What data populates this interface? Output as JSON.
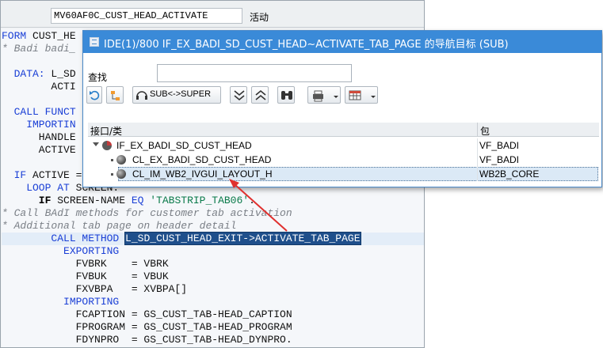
{
  "editor": {
    "object_name": "MV60AF0C_CUST_HEAD_ACTIVATE",
    "status": "活动",
    "lines": [
      {
        "parts": [
          {
            "t": "FORM",
            "c": "k-blue"
          },
          {
            "t": " CUST_HE",
            "c": ""
          }
        ]
      },
      {
        "parts": [
          {
            "t": "* Badi badi_",
            "c": "c-comment"
          }
        ]
      },
      {
        "parts": [
          {
            "t": "",
            "c": ""
          }
        ]
      },
      {
        "parts": [
          {
            "t": "  DATA:",
            "c": "k-blue"
          },
          {
            "t": " L_SD",
            "c": ""
          }
        ]
      },
      {
        "parts": [
          {
            "t": "        ACTI",
            "c": ""
          }
        ]
      },
      {
        "parts": [
          {
            "t": "",
            "c": ""
          }
        ]
      },
      {
        "parts": [
          {
            "t": "  CALL FUNCT",
            "c": "k-blue"
          }
        ]
      },
      {
        "parts": [
          {
            "t": "    IMPORTIN",
            "c": "k-blue"
          }
        ]
      },
      {
        "parts": [
          {
            "t": "      HANDLE",
            "c": ""
          }
        ]
      },
      {
        "parts": [
          {
            "t": "      ACTIVE",
            "c": ""
          }
        ]
      },
      {
        "parts": [
          {
            "t": "",
            "c": ""
          }
        ]
      },
      {
        "parts": [
          {
            "t": "  IF",
            "c": "k-blue"
          },
          {
            "t": " ACTIVE =",
            "c": ""
          }
        ]
      },
      {
        "parts": [
          {
            "t": "    LOOP AT",
            "c": "k-blue"
          },
          {
            "t": " SCREEN.",
            "c": ""
          }
        ]
      },
      {
        "parts": [
          {
            "t": "      IF",
            "c": "k-black"
          },
          {
            "t": " SCREEN-NAME ",
            "c": ""
          },
          {
            "t": "EQ",
            "c": "k-blue"
          },
          {
            "t": " ",
            "c": ""
          },
          {
            "t": "'TABSTRIP_TAB06'",
            "c": "c-str"
          },
          {
            "t": ".",
            "c": ""
          }
        ]
      },
      {
        "parts": [
          {
            "t": "* Call BAdI methods for customer tab activation",
            "c": "c-comment"
          }
        ]
      },
      {
        "parts": [
          {
            "t": "* Additional tab page on header detail",
            "c": "c-comment"
          }
        ]
      },
      {
        "cur": true,
        "parts": [
          {
            "t": "        CALL METHOD",
            "c": "k-blue"
          },
          {
            "t": " ",
            "c": ""
          },
          {
            "t": "L_SD_CUST_HEAD_EXIT->ACTIVATE_TAB_PAGE",
            "c": "c-sel"
          }
        ]
      },
      {
        "parts": [
          {
            "t": "          EXPORTING",
            "c": "k-blue"
          }
        ]
      },
      {
        "parts": [
          {
            "t": "            FVBRK    = VBRK",
            "c": ""
          }
        ]
      },
      {
        "parts": [
          {
            "t": "            FVBUK    = VBUK",
            "c": ""
          }
        ]
      },
      {
        "parts": [
          {
            "t": "            FXVBPA   = XVBPA[]",
            "c": ""
          }
        ]
      },
      {
        "parts": [
          {
            "t": "          IMPORTING",
            "c": "k-blue"
          }
        ]
      },
      {
        "parts": [
          {
            "t": "            FCAPTION = GS_CUST_TAB-HEAD_CAPTION",
            "c": ""
          }
        ]
      },
      {
        "parts": [
          {
            "t": "            FPROGRAM = GS_CUST_TAB-HEAD_PROGRAM",
            "c": ""
          }
        ]
      },
      {
        "parts": [
          {
            "t": "            FDYNPRO  = GS_CUST_TAB-HEAD_DYNPRO.",
            "c": ""
          }
        ]
      }
    ]
  },
  "popup": {
    "title": "IDE(1)/800 IF_EX_BADI_SD_CUST_HEAD~ACTIVATE_TAB_PAGE 的导航目标 (SUB)",
    "find_label": "查找",
    "find_value": "",
    "toolbar": {
      "sub_super_label": "SUB<->SUPER"
    },
    "tree": {
      "columns": [
        "接口/类",
        "包"
      ],
      "rows": [
        {
          "name": "IF_EX_BADI_SD_CUST_HEAD",
          "package": "VF_BADI",
          "icon": "interface-icon",
          "level": 0,
          "expanded": true,
          "selected": false
        },
        {
          "name": "CL_EX_BADI_SD_CUST_HEAD",
          "package": "VF_BADI",
          "icon": "class-icon",
          "level": 1,
          "expanded": false,
          "selected": false
        },
        {
          "name": "CL_IM_WB2_IVGUI_LAYOUT_H",
          "package": "WB2B_CORE",
          "icon": "class-icon",
          "level": 1,
          "expanded": false,
          "selected": true
        }
      ]
    }
  },
  "colors": {
    "titlebar": "#3a8ad8",
    "annotation_arrow": "#e0302e",
    "selection": "#1f4f8b"
  }
}
